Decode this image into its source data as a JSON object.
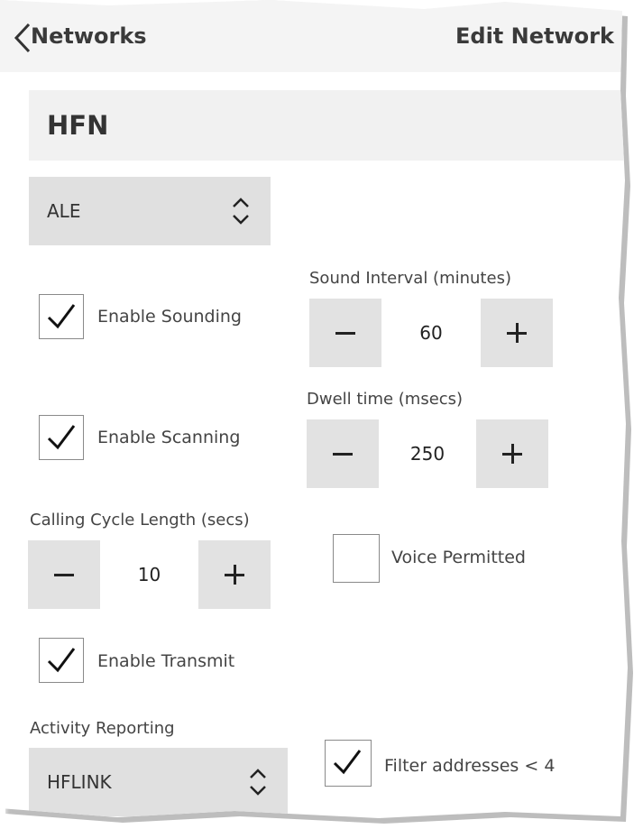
{
  "header": {
    "back_label": "Networks",
    "title": "Edit Network"
  },
  "network_name": "HFN",
  "protocol_select": {
    "value": "ALE"
  },
  "enable_sounding": {
    "label": "Enable Sounding",
    "checked": true
  },
  "sound_interval": {
    "label": "Sound Interval (minutes)",
    "value": "60"
  },
  "enable_scanning": {
    "label": "Enable Scanning",
    "checked": true
  },
  "dwell_time": {
    "label": "Dwell time (msecs)",
    "value": "250"
  },
  "calling_cycle": {
    "label": "Calling Cycle Length (secs)",
    "value": "10"
  },
  "voice_permitted": {
    "label": "Voice Permitted",
    "checked": false
  },
  "enable_transmit": {
    "label": "Enable Transmit",
    "checked": true
  },
  "activity_reporting": {
    "label": "Activity Reporting",
    "value": "HFLINK"
  },
  "filter_addresses": {
    "label": "Filter addresses < 4",
    "checked": true
  }
}
